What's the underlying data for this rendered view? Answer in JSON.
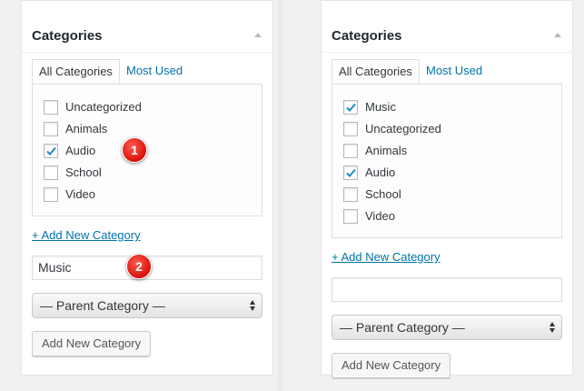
{
  "left_panel": {
    "title": "Categories",
    "tabs": [
      {
        "label": "All Categories",
        "active": true
      },
      {
        "label": "Most Used",
        "active": false
      }
    ],
    "categories": [
      {
        "label": "Uncategorized",
        "checked": false
      },
      {
        "label": "Animals",
        "checked": false
      },
      {
        "label": "Audio",
        "checked": true
      },
      {
        "label": "School",
        "checked": false
      },
      {
        "label": "Video",
        "checked": false
      }
    ],
    "add_link": "+ Add New Category",
    "new_category_value": "Music",
    "parent_select": "— Parent Category —",
    "add_button": "Add New Category",
    "markers": [
      "1",
      "2"
    ]
  },
  "right_panel": {
    "title": "Categories",
    "tabs": [
      {
        "label": "All Categories",
        "active": true
      },
      {
        "label": "Most Used",
        "active": false
      }
    ],
    "categories": [
      {
        "label": "Music",
        "checked": true
      },
      {
        "label": "Uncategorized",
        "checked": false
      },
      {
        "label": "Animals",
        "checked": false
      },
      {
        "label": "Audio",
        "checked": true
      },
      {
        "label": "School",
        "checked": false
      },
      {
        "label": "Video",
        "checked": false
      }
    ],
    "add_link": "+ Add New Category",
    "new_category_value": "",
    "parent_select": "— Parent Category —",
    "add_button": "Add New Category"
  },
  "colors": {
    "link": "#0073aa",
    "check": "#1e8cbe",
    "marker": "#e0190f"
  },
  "icons": {
    "collapse": "triangle-up-icon",
    "check": "checkmark-icon",
    "select_arrows": "updown-arrows-icon"
  }
}
